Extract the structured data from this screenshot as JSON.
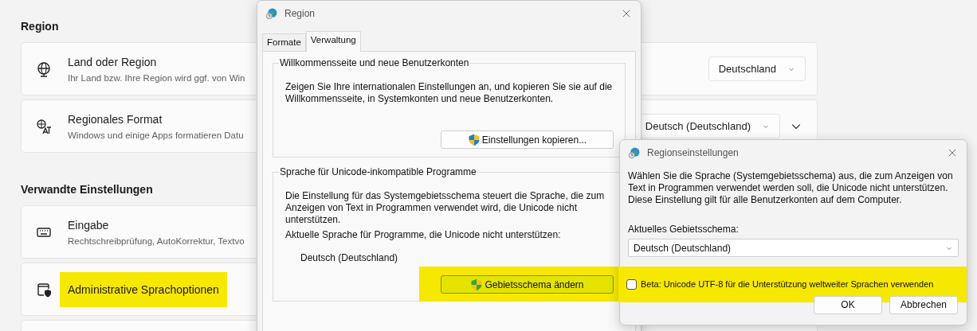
{
  "settings": {
    "sections": [
      {
        "title": "Region",
        "items": [
          {
            "title": "Land oder Region",
            "subtitle": "Ihr Land bzw. Ihre Region wird ggf. von Win",
            "dropdown": "Deutschland",
            "highlighted": false
          },
          {
            "title": "Regionales Format",
            "subtitle": "Windows und einige Apps formatieren Datu",
            "dropdown": "Deutsch (Deutschland)",
            "expanded": false,
            "highlighted": false
          }
        ]
      },
      {
        "title": "Verwandte Einstellungen",
        "items": [
          {
            "title": "Eingabe",
            "subtitle": "Rechtschreibprüfung, AutoKorrektur, Textvo",
            "highlighted": false
          },
          {
            "title": "Administrative Sprachoptionen",
            "highlighted": true
          }
        ]
      }
    ]
  },
  "region_dialog": {
    "title": "Region",
    "tabs": [
      {
        "label": "Formate",
        "selected": false
      },
      {
        "label": "Verwaltung",
        "selected": true
      }
    ],
    "groups": [
      {
        "legend": "Willkommensseite und neue Benutzerkonten",
        "text": "Zeigen Sie Ihre internationalen Einstellungen an, und kopieren Sie sie auf die Willkommensseite, in Systemkonten und neue Benutzerkonten.",
        "button": {
          "label": "Einstellungen kopieren...",
          "highlighted": false
        }
      },
      {
        "legend": "Sprache für Unicode-inkompatible Programme",
        "text": "Die Einstellung für das Systemgebietsschema steuert die Sprache, die zum Anzeigen von Text in Programmen verwendet wird, die Unicode nicht unterstützen.",
        "current_label": "Aktuelle Sprache für Programme, die Unicode nicht unterstützen:",
        "current_value": "Deutsch (Deutschland)",
        "button": {
          "label": "Gebietsschema ändern",
          "highlighted": true
        }
      }
    ]
  },
  "locale_dialog": {
    "title": "Regionseinstellungen",
    "text": "Wählen Sie die Sprache (Systemgebietsschema) aus, die zum Anzeigen von Text in Programmen verwendet werden soll, die Unicode nicht unterstützen. Diese Einstellung gilt für alle Benutzerkonten auf dem Computer.",
    "select_label": "Aktuelles Gebietsschema:",
    "select_value": "Deutsch (Deutschland)",
    "checkbox": {
      "label": "Beta: Unicode UTF-8 für die Unterstützung weltweiter Sprachen verwenden",
      "checked": false,
      "highlighted": true
    },
    "buttons": [
      "OK",
      "Abbrechen"
    ]
  }
}
